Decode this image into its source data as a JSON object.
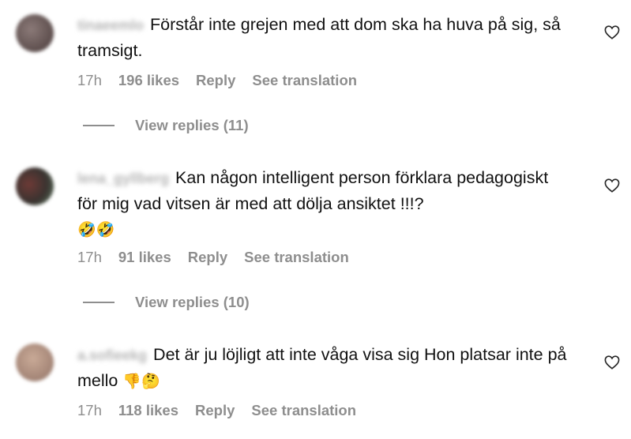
{
  "comments": [
    {
      "username": "tinaeemlo",
      "text": "Förstår inte grejen med att dom ska ha huva på sig, så tramsigt.",
      "emoji": "",
      "time": "17h",
      "likes": "196 likes",
      "reply_label": "Reply",
      "translate_label": "See translation",
      "view_replies": "View replies (11)"
    },
    {
      "username": "lena_gyllberg",
      "text": "Kan någon intelligent person förklara pedagogiskt för mig vad vitsen är med att dölja ansiktet !!!?",
      "emoji": "🤣🤣",
      "time": "17h",
      "likes": "91 likes",
      "reply_label": "Reply",
      "translate_label": "See translation",
      "view_replies": "View replies (10)"
    },
    {
      "username": "a.sofieekg",
      "text": "Det är ju löjligt att inte våga visa sig Hon platsar inte på mello",
      "emoji": "👎🤔",
      "time": "17h",
      "likes": "118 likes",
      "reply_label": "Reply",
      "translate_label": "See translation"
    }
  ],
  "icons": {
    "like": "heart-outline-icon"
  },
  "colors": {
    "meta": "#8e8e8e",
    "text": "#111111",
    "background": "#ffffff"
  }
}
